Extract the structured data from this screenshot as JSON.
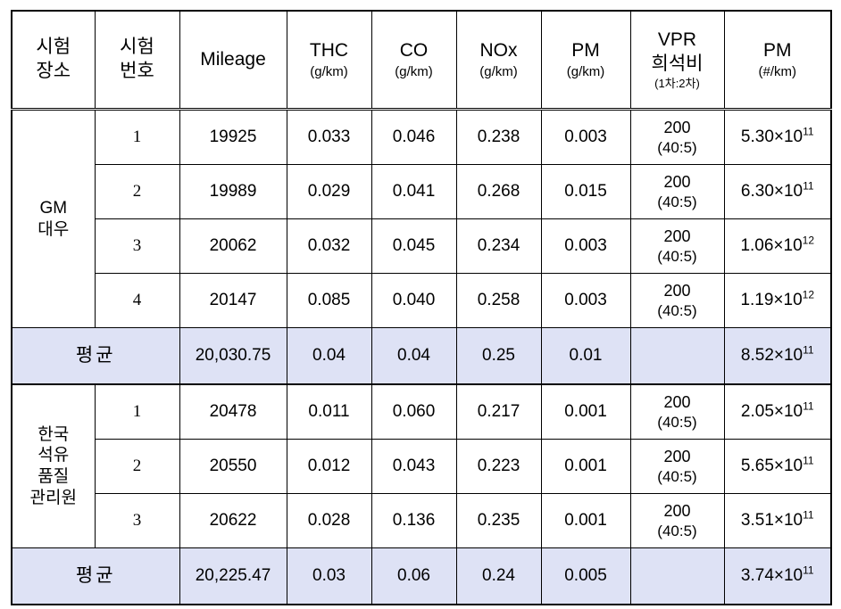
{
  "table": {
    "columns": [
      {
        "key": "place",
        "main": "시험",
        "sub": "장소",
        "unit": ""
      },
      {
        "key": "testno",
        "main": "시험",
        "sub": "번호",
        "unit": ""
      },
      {
        "key": "mileage",
        "main": "Mileage",
        "sub": "",
        "unit": ""
      },
      {
        "key": "thc",
        "main": "THC",
        "sub": "",
        "unit": "(g/km)"
      },
      {
        "key": "co",
        "main": "CO",
        "sub": "",
        "unit": "(g/km)"
      },
      {
        "key": "nox",
        "main": "NOx",
        "sub": "",
        "unit": "(g/km)"
      },
      {
        "key": "pm",
        "main": "PM",
        "sub": "",
        "unit": "(g/km)"
      },
      {
        "key": "vpr",
        "main": "VPR",
        "sub": "희석비",
        "unit": "(1차:2차)"
      },
      {
        "key": "pmnum",
        "main": "PM",
        "sub": "",
        "unit": "(#/km)"
      }
    ],
    "header": {
      "col1_line1": "시험",
      "col1_line2": "장소",
      "col2_line1": "시험",
      "col2_line2": "번호",
      "col3": "Mileage",
      "col4_name": "THC",
      "col4_unit": "(g/km)",
      "col5_name": "CO",
      "col5_unit": "(g/km)",
      "col6_name": "NOx",
      "col6_unit": "(g/km)",
      "col7_name": "PM",
      "col7_unit": "(g/km)",
      "col8_line1": "VPR",
      "col8_line2": "희석비",
      "col8_unit": "(1차:2차)",
      "col9_name": "PM",
      "col9_unit": "(#/km)"
    },
    "average_label": "평균",
    "sections": [
      {
        "place_line1": "GM",
        "place_line2": "대우",
        "rows": [
          {
            "testno": "1",
            "mileage": "19925",
            "thc": "0.033",
            "co": "0.046",
            "nox": "0.238",
            "pm": "0.003",
            "vpr_ratio": "200",
            "vpr_detail": "(40:5)",
            "pmnum_base": "5.30×10",
            "pmnum_exp": "11"
          },
          {
            "testno": "2",
            "mileage": "19989",
            "thc": "0.029",
            "co": "0.041",
            "nox": "0.268",
            "pm": "0.015",
            "vpr_ratio": "200",
            "vpr_detail": "(40:5)",
            "pmnum_base": "6.30×10",
            "pmnum_exp": "11"
          },
          {
            "testno": "3",
            "mileage": "20062",
            "thc": "0.032",
            "co": "0.045",
            "nox": "0.234",
            "pm": "0.003",
            "vpr_ratio": "200",
            "vpr_detail": "(40:5)",
            "pmnum_base": "1.06×10",
            "pmnum_exp": "12"
          },
          {
            "testno": "4",
            "mileage": "20147",
            "thc": "0.085",
            "co": "0.040",
            "nox": "0.258",
            "pm": "0.003",
            "vpr_ratio": "200",
            "vpr_detail": "(40:5)",
            "pmnum_base": "1.19×10",
            "pmnum_exp": "12"
          }
        ],
        "average": {
          "label": "평균",
          "mileage": "20,030.75",
          "thc": "0.04",
          "co": "0.04",
          "nox": "0.25",
          "pm": "0.01",
          "vpr_ratio": "",
          "vpr_detail": "",
          "pmnum_base": "8.52×10",
          "pmnum_exp": "11"
        }
      },
      {
        "place_line1": "한국",
        "place_line2": "석유",
        "place_line3": "품질",
        "place_line4": "관리원",
        "rows": [
          {
            "testno": "1",
            "mileage": "20478",
            "thc": "0.011",
            "co": "0.060",
            "nox": "0.217",
            "pm": "0.001",
            "vpr_ratio": "200",
            "vpr_detail": "(40:5)",
            "pmnum_base": "2.05×10",
            "pmnum_exp": "11"
          },
          {
            "testno": "2",
            "mileage": "20550",
            "thc": "0.012",
            "co": "0.043",
            "nox": "0.223",
            "pm": "0.001",
            "vpr_ratio": "200",
            "vpr_detail": "(40:5)",
            "pmnum_base": "5.65×10",
            "pmnum_exp": "11"
          },
          {
            "testno": "3",
            "mileage": "20622",
            "thc": "0.028",
            "co": "0.136",
            "nox": "0.235",
            "pm": "0.001",
            "vpr_ratio": "200",
            "vpr_detail": "(40:5)",
            "pmnum_base": "3.51×10",
            "pmnum_exp": "11"
          }
        ],
        "average": {
          "label": "평균",
          "mileage": "20,225.47",
          "thc": "0.03",
          "co": "0.06",
          "nox": "0.24",
          "pm": "0.005",
          "vpr_ratio": "",
          "vpr_detail": "",
          "pmnum_base": "3.74×10",
          "pmnum_exp": "11"
        }
      }
    ]
  },
  "colors": {
    "average_row_background": "#dee2f5",
    "border": "#000000",
    "text": "#000000",
    "page_background": "#ffffff"
  }
}
